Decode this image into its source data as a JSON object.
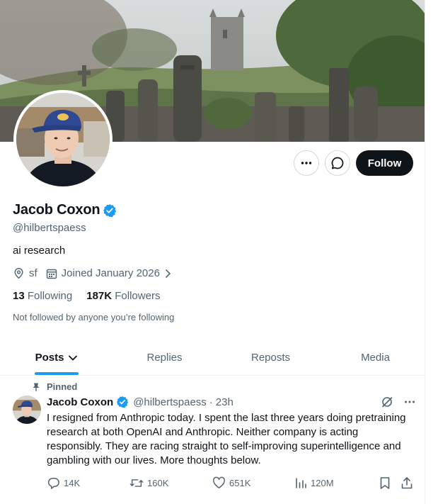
{
  "profile": {
    "name": "Jacob Coxon",
    "handle": "@hilbertspaess",
    "bio": "ai research",
    "location": "sf",
    "joined": "Joined January 2026",
    "following_count": "13",
    "following_label": "Following",
    "followers_count": "187K",
    "followers_label": "Followers",
    "followed_note": "Not followed by anyone you’re following",
    "follow_button": "Follow",
    "verified": true,
    "accent_color": "#1d9bf0"
  },
  "tabs": [
    {
      "label": "Posts",
      "active": true
    },
    {
      "label": "Replies",
      "active": false
    },
    {
      "label": "Reposts",
      "active": false
    },
    {
      "label": "Media",
      "active": false
    }
  ],
  "post": {
    "pinned_label": "Pinned",
    "author_name": "Jacob Coxon",
    "author_handle": "@hilbertspaess",
    "separator": "·",
    "time": "23h",
    "text": "I resigned from Anthropic today. I spent the last three years doing pretraining research at both OpenAI and Anthropic. Neither company is acting responsibly. They are racing straight to self-improving superintelligence and gambling with our lives. More thoughts below.",
    "stats": {
      "replies": "14K",
      "reposts": "160K",
      "likes": "651K",
      "views": "120M"
    }
  },
  "icons": {
    "more": "more-dots-icon",
    "message": "message-bubble-icon",
    "verified": "verified-badge-icon",
    "location": "location-pin-icon",
    "calendar": "calendar-icon",
    "chevron": "chevron-right-icon",
    "pin": "pin-icon",
    "grok": "grok-icon",
    "reply": "reply-icon",
    "repost": "repost-icon",
    "like": "heart-icon",
    "views": "views-icon",
    "bookmark": "bookmark-icon",
    "share": "share-icon"
  }
}
